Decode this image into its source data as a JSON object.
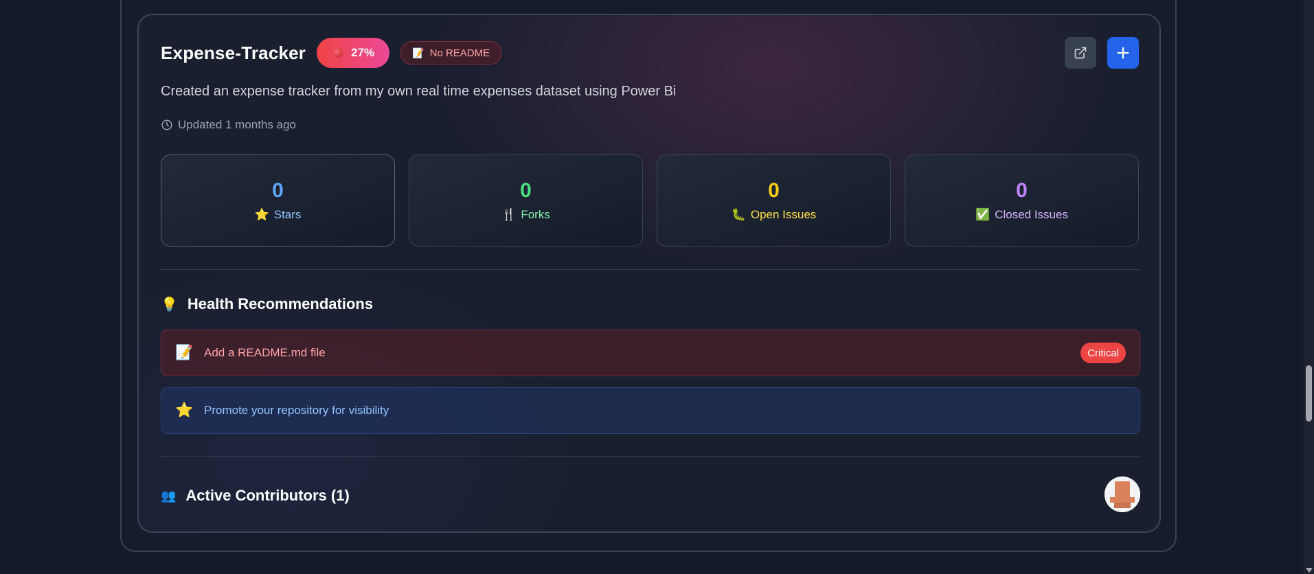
{
  "repo": {
    "name": "Expense-Tracker",
    "health_percent": "27%",
    "readme_badge": "No README",
    "description": "Created an expense tracker from my own real time expenses dataset using Power Bi",
    "updated": "Updated 1 months ago"
  },
  "stats": [
    {
      "value": "0",
      "label": "Stars",
      "icon": "star-icon",
      "value_color": "#60a5fa",
      "label_color": "#93c5fd"
    },
    {
      "value": "0",
      "label": "Forks",
      "icon": "fork-icon",
      "value_color": "#4ade80",
      "label_color": "#86efac"
    },
    {
      "value": "0",
      "label": "Open Issues",
      "icon": "bug-icon",
      "value_color": "#facc15",
      "label_color": "#fde047"
    },
    {
      "value": "0",
      "label": "Closed Issues",
      "icon": "check-box-icon",
      "value_color": "#c084fc",
      "label_color": "#d8b4fe"
    }
  ],
  "recommendations": {
    "title": "Health Recommendations",
    "items": [
      {
        "text": "Add a README.md file",
        "tag": "Critical",
        "icon": "memo-icon"
      },
      {
        "text": "Promote your repository for visibility",
        "icon": "star-icon"
      }
    ]
  },
  "contributors": {
    "title": "Active Contributors (1)"
  },
  "colors": {
    "accent_blue": "#2563eb",
    "health_gradient_start": "#ef4444",
    "health_gradient_end": "#ec4899",
    "critical": "#ef4444"
  }
}
